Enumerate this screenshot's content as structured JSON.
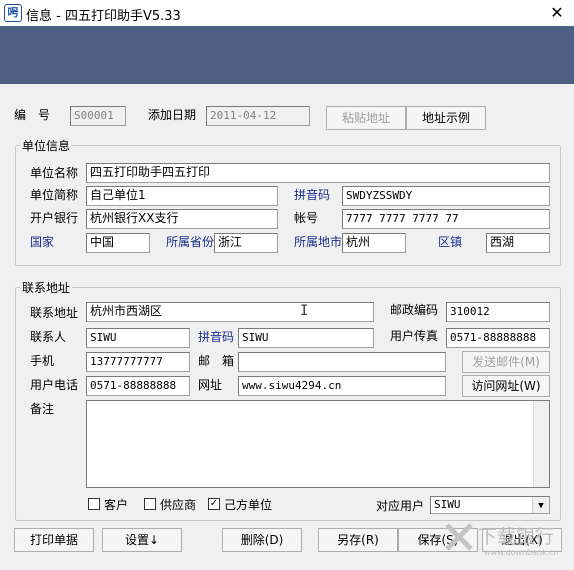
{
  "window": {
    "title": "信息 - 四五打印助手V5.33",
    "close_glyph": "✕",
    "icon_glyph": "呺"
  },
  "header": {
    "number_label": "编　号",
    "number_value": "S00001",
    "date_label": "添加日期",
    "date_value": "2011-04-12",
    "paste_button": "粘贴地址",
    "example_button": "地址示例"
  },
  "unit": {
    "group_title": "单位信息",
    "name_label": "单位名称",
    "name_value": "四五打印助手四五打印",
    "short_label": "单位简称",
    "short_value": "自己单位1",
    "pinyin_label": "拼音码",
    "pinyin_value": "SWDYZSSWDY",
    "bank_label": "开户银行",
    "bank_value": "杭州银行XX支行",
    "account_label": "帐号",
    "account_value": "7777 7777 7777 77",
    "country_label": "国家",
    "country_value": "中国",
    "province_label": "所属省份",
    "province_value": "浙江",
    "city_label": "所属地市",
    "city_value": "杭州",
    "district_label": "区镇",
    "district_value": "西湖"
  },
  "contact": {
    "group_title": "联系地址",
    "address_label": "联系地址",
    "address_value": "杭州市西湖区",
    "zip_label": "邮政编码",
    "zip_value": "310012",
    "person_label": "联系人",
    "person_value": "SIWU",
    "pinyin_label": "拼音码",
    "pinyin_value": "SIWU",
    "fax_label": "用户传真",
    "fax_value": "0571-88888888",
    "mobile_label": "手机",
    "mobile_value": "13777777777",
    "email_label": "邮　箱",
    "email_value": "",
    "send_mail_button": "发送邮件(M)",
    "phone_label": "用户电话",
    "phone_value": "0571-88888888",
    "website_label": "网址",
    "website_value": "www.siwu4294.cn",
    "visit_button": "访问网址(W)",
    "note_label": "备注",
    "note_value": ""
  },
  "flags": {
    "customer_label": "客户",
    "customer_checked": false,
    "supplier_label": "供应商",
    "supplier_checked": false,
    "own_label": "己方单位",
    "own_checked": true,
    "check_glyph": "✓",
    "user_label": "对应用户",
    "user_value": "SIWU",
    "dropdown_glyph": "▼"
  },
  "footer": {
    "print_button": "打印单据",
    "settings_button": "设置↓",
    "delete_button": "删除(D)",
    "saveas_button": "另存(R)",
    "save_button": "保存(S)",
    "exit_button": "退出(X)"
  },
  "watermark": {
    "text": "下载银行",
    "url": "www.downbank.cn"
  },
  "colors": {
    "banner": "#4d5f82",
    "blue_label": "#1a2d8c"
  }
}
